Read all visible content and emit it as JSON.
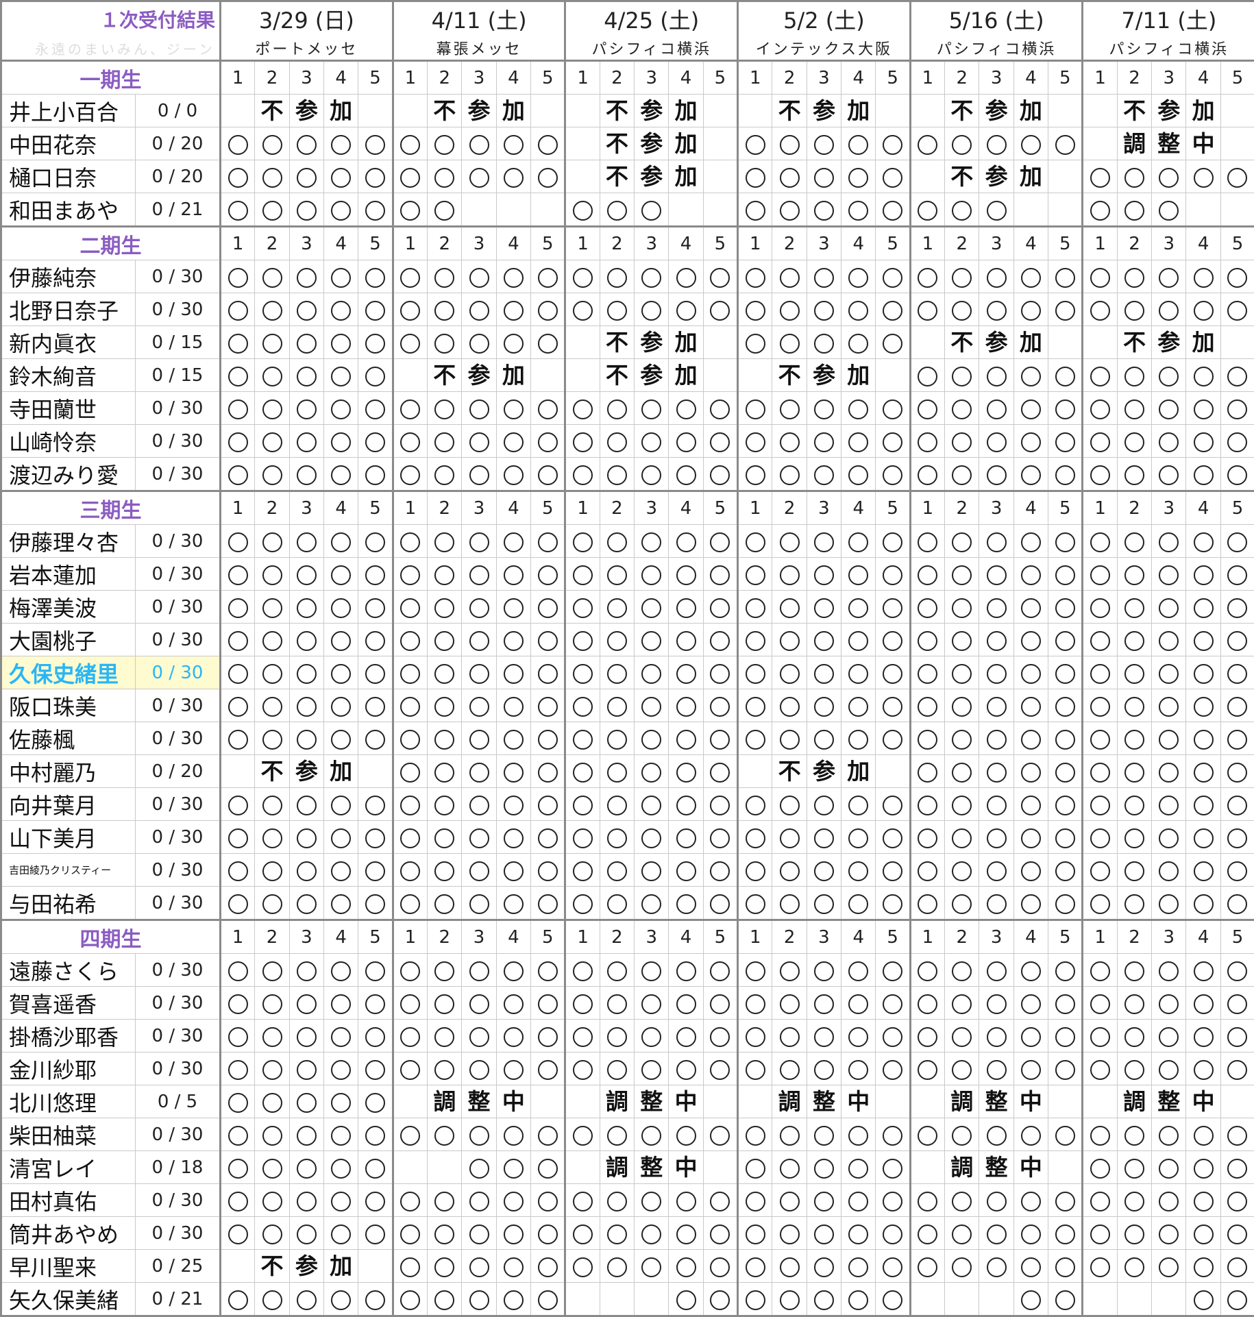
{
  "title": "１次受付結果",
  "subtitle": "永遠のまいみん、ジーン",
  "slot_labels": [
    "1",
    "2",
    "3",
    "4",
    "5"
  ],
  "events": [
    {
      "date": "3/29 (日)",
      "venue": "ポートメッセ"
    },
    {
      "date": "4/11 (土)",
      "venue": "幕張メッセ"
    },
    {
      "date": "4/25 (土)",
      "venue": "パシフィコ横浜"
    },
    {
      "date": "5/2 (土)",
      "venue": "インテックス大阪"
    },
    {
      "date": "5/16 (土)",
      "venue": "パシフィコ横浜"
    },
    {
      "date": "7/11 (土)",
      "venue": "パシフィコ横浜"
    }
  ],
  "groups": [
    {
      "label": "一期生",
      "members": [
        {
          "name": "井上小百合",
          "count": "0 / 0",
          "cells": [
            "N",
            "N",
            "N",
            "N",
            "N",
            "N"
          ]
        },
        {
          "name": "中田花奈",
          "count": "0 / 20",
          "cells": [
            "ooooo",
            "ooooo",
            "N",
            "ooooo",
            "ooooo",
            "A"
          ]
        },
        {
          "name": "樋口日奈",
          "count": "0 / 20",
          "cells": [
            "ooooo",
            "ooooo",
            "N",
            "ooooo",
            "N",
            "ooooo"
          ]
        },
        {
          "name": "和田まあや",
          "count": "0 / 21",
          "cells": [
            "ooooo",
            "oo---",
            "ooo--",
            "ooooo",
            "ooo--",
            "ooo--"
          ]
        }
      ]
    },
    {
      "label": "二期生",
      "members": [
        {
          "name": "伊藤純奈",
          "count": "0 / 30",
          "cells": [
            "ooooo",
            "ooooo",
            "ooooo",
            "ooooo",
            "ooooo",
            "ooooo"
          ]
        },
        {
          "name": "北野日奈子",
          "count": "0 / 30",
          "cells": [
            "ooooo",
            "ooooo",
            "ooooo",
            "ooooo",
            "ooooo",
            "ooooo"
          ]
        },
        {
          "name": "新内眞衣",
          "count": "0 / 15",
          "cells": [
            "ooooo",
            "ooooo",
            "N",
            "ooooo",
            "N",
            "N"
          ]
        },
        {
          "name": "鈴木絢音",
          "count": "0 / 15",
          "cells": [
            "ooooo",
            "N",
            "N",
            "N",
            "ooooo",
            "ooooo"
          ]
        },
        {
          "name": "寺田蘭世",
          "count": "0 / 30",
          "cells": [
            "ooooo",
            "ooooo",
            "ooooo",
            "ooooo",
            "ooooo",
            "ooooo"
          ]
        },
        {
          "name": "山崎怜奈",
          "count": "0 / 30",
          "cells": [
            "ooooo",
            "ooooo",
            "ooooo",
            "ooooo",
            "ooooo",
            "ooooo"
          ]
        },
        {
          "name": "渡辺みり愛",
          "count": "0 / 30",
          "cells": [
            "ooooo",
            "ooooo",
            "ooooo",
            "ooooo",
            "ooooo",
            "ooooo"
          ]
        }
      ]
    },
    {
      "label": "三期生",
      "members": [
        {
          "name": "伊藤理々杏",
          "count": "0 / 30",
          "cells": [
            "ooooo",
            "ooooo",
            "ooooo",
            "ooooo",
            "ooooo",
            "ooooo"
          ]
        },
        {
          "name": "岩本蓮加",
          "count": "0 / 30",
          "cells": [
            "ooooo",
            "ooooo",
            "ooooo",
            "ooooo",
            "ooooo",
            "ooooo"
          ]
        },
        {
          "name": "梅澤美波",
          "count": "0 / 30",
          "cells": [
            "ooooo",
            "ooooo",
            "ooooo",
            "ooooo",
            "ooooo",
            "ooooo"
          ]
        },
        {
          "name": "大園桃子",
          "count": "0 / 30",
          "cells": [
            "ooooo",
            "ooooo",
            "ooooo",
            "ooooo",
            "ooooo",
            "ooooo"
          ]
        },
        {
          "name": "久保史緒里",
          "count": "0 / 30",
          "highlight": true,
          "cells": [
            "ooooo",
            "ooooo",
            "ooooo",
            "ooooo",
            "ooooo",
            "ooooo"
          ]
        },
        {
          "name": "阪口珠美",
          "count": "0 / 30",
          "cells": [
            "ooooo",
            "ooooo",
            "ooooo",
            "ooooo",
            "ooooo",
            "ooooo"
          ]
        },
        {
          "name": "佐藤楓",
          "count": "0 / 30",
          "cells": [
            "ooooo",
            "ooooo",
            "ooooo",
            "ooooo",
            "ooooo",
            "ooooo"
          ]
        },
        {
          "name": "中村麗乃",
          "count": "0 / 20",
          "cells": [
            "N",
            "ooooo",
            "ooooo",
            "N",
            "ooooo",
            "ooooo"
          ]
        },
        {
          "name": "向井葉月",
          "count": "0 / 30",
          "cells": [
            "ooooo",
            "ooooo",
            "ooooo",
            "ooooo",
            "ooooo",
            "ooooo"
          ]
        },
        {
          "name": "山下美月",
          "count": "0 / 30",
          "cells": [
            "ooooo",
            "ooooo",
            "ooooo",
            "ooooo",
            "ooooo",
            "ooooo"
          ]
        },
        {
          "name": "吉田綾乃クリスティー",
          "count": "0 / 30",
          "small": true,
          "cells": [
            "ooooo",
            "ooooo",
            "ooooo",
            "ooooo",
            "ooooo",
            "ooooo"
          ]
        },
        {
          "name": "与田祐希",
          "count": "0 / 30",
          "cells": [
            "ooooo",
            "ooooo",
            "ooooo",
            "ooooo",
            "ooooo",
            "ooooo"
          ]
        }
      ]
    },
    {
      "label": "四期生",
      "members": [
        {
          "name": "遠藤さくら",
          "count": "0 / 30",
          "cells": [
            "ooooo",
            "ooooo",
            "ooooo",
            "ooooo",
            "ooooo",
            "ooooo"
          ]
        },
        {
          "name": "賀喜遥香",
          "count": "0 / 30",
          "cells": [
            "ooooo",
            "ooooo",
            "ooooo",
            "ooooo",
            "ooooo",
            "ooooo"
          ]
        },
        {
          "name": "掛橋沙耶香",
          "count": "0 / 30",
          "cells": [
            "ooooo",
            "ooooo",
            "ooooo",
            "ooooo",
            "ooooo",
            "ooooo"
          ]
        },
        {
          "name": "金川紗耶",
          "count": "0 / 30",
          "cells": [
            "ooooo",
            "ooooo",
            "ooooo",
            "ooooo",
            "ooooo",
            "ooooo"
          ]
        },
        {
          "name": "北川悠理",
          "count": "0 / 5",
          "cells": [
            "ooooo",
            "A",
            "A",
            "A",
            "A",
            "A"
          ]
        },
        {
          "name": "柴田柚菜",
          "count": "0 / 30",
          "cells": [
            "ooooo",
            "ooooo",
            "ooooo",
            "ooooo",
            "ooooo",
            "ooooo"
          ]
        },
        {
          "name": "清宮レイ",
          "count": "0 / 18",
          "cells": [
            "ooooo",
            "--ooo",
            "A",
            "ooooo",
            "A",
            "ooooo"
          ]
        },
        {
          "name": "田村真佑",
          "count": "0 / 30",
          "cells": [
            "ooooo",
            "ooooo",
            "ooooo",
            "ooooo",
            "ooooo",
            "ooooo"
          ]
        },
        {
          "name": "筒井あやめ",
          "count": "0 / 30",
          "cells": [
            "ooooo",
            "ooooo",
            "ooooo",
            "ooooo",
            "ooooo",
            "ooooo"
          ]
        },
        {
          "name": "早川聖来",
          "count": "0 / 25",
          "cells": [
            "N",
            "ooooo",
            "ooooo",
            "ooooo",
            "ooooo",
            "ooooo"
          ]
        },
        {
          "name": "矢久保美緒",
          "count": "0 / 21",
          "cells": [
            "ooooo",
            "ooooo",
            "---oo",
            "ooooo",
            "---oo",
            "---oo"
          ]
        }
      ]
    }
  ],
  "notes": {
    "N": [
      "不",
      "参",
      "加"
    ],
    "A": [
      "調",
      "整",
      "中"
    ]
  }
}
